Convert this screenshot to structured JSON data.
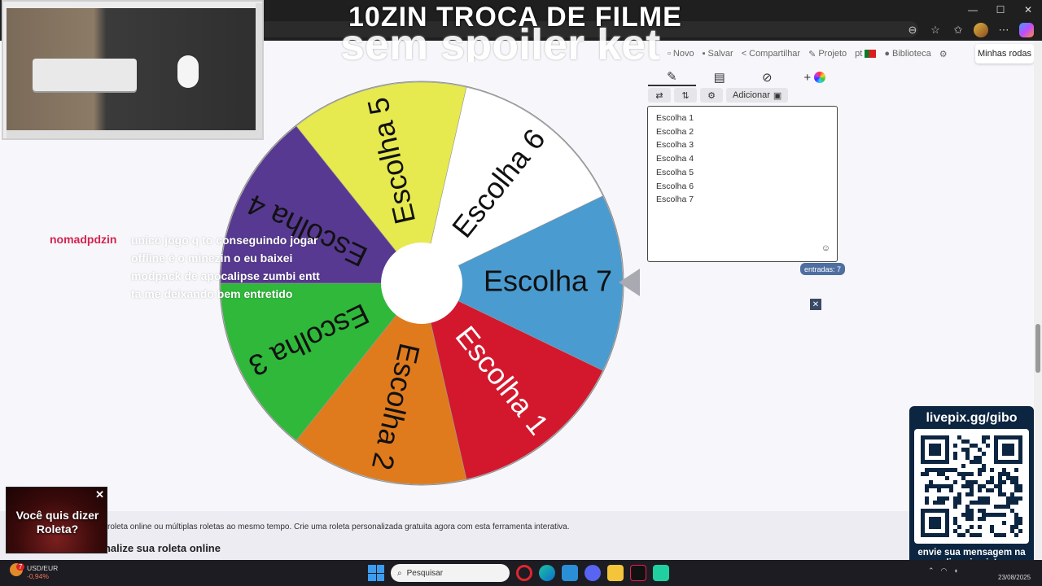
{
  "stream": {
    "title": "10ZIN TROCA DE FILME",
    "subtitle": "sem spoiler ket"
  },
  "browser": {
    "window_controls": [
      "—",
      "☐",
      "✕"
    ],
    "addr_icons": [
      "share-icon",
      "star-icon",
      "favorites-icon",
      "profile-avatar-icon",
      "copilot-icon"
    ]
  },
  "site_nav": {
    "items": [
      {
        "icon": "new-icon",
        "label": "Novo"
      },
      {
        "icon": "save-icon",
        "label": "Salvar"
      },
      {
        "icon": "share-icon",
        "label": "Compartilhar"
      },
      {
        "icon": "project-icon",
        "label": "Projeto"
      },
      {
        "icon": "language-icon",
        "label": "pt"
      },
      {
        "icon": "library-icon",
        "label": "Biblioteca"
      }
    ],
    "my_wheels_label": "Minhas rodas"
  },
  "wheel": {
    "segments": [
      {
        "label": "Escolha 1",
        "color": "#d3182d"
      },
      {
        "label": "Escolha 2",
        "color": "#e07b1d"
      },
      {
        "label": "Escolha 3",
        "color": "#2fb83a"
      },
      {
        "label": "Escolha 4",
        "color": "#573991"
      },
      {
        "label": "Escolha 5",
        "color": "#e6ea4f"
      },
      {
        "label": "Escolha 6",
        "color": "#ffffff"
      },
      {
        "label": "Escolha 7",
        "color": "#4a9bd0"
      }
    ]
  },
  "chat": {
    "user": "nomadpdzin",
    "message": "unico jogo q to conseguindo jogar offline é o minezin o eu baixei modpack de apocalipse zumbi entt ta me deixando bem entretido"
  },
  "editor": {
    "tabs": [
      {
        "icon": "pencil-icon",
        "label": "✎"
      },
      {
        "icon": "clipboard-icon",
        "label": "📋"
      },
      {
        "icon": "eye-off-icon",
        "label": "◌"
      },
      {
        "icon": "add-color-icon",
        "label": "+"
      }
    ],
    "tools": [
      {
        "icon": "shuffle-icon",
        "label": "⇄"
      },
      {
        "icon": "sort-icon",
        "label": "⇅"
      },
      {
        "icon": "settings-icon",
        "label": "⚙"
      }
    ],
    "add_label": "Adicionar",
    "entries": [
      "Escolha 1",
      "Escolha 2",
      "Escolha 3",
      "Escolha 4",
      "Escolha 5",
      "Escolha 6",
      "Escolha 7"
    ],
    "entries_count": "entradas: 7",
    "emoji": "☺",
    "close": "✕"
  },
  "page": {
    "description": "roleta online ou múltiplas roletas ao mesmo tempo. Crie uma roleta personalizada gratuita agora com esta ferramenta interativa.",
    "heading": "onalize sua roleta online"
  },
  "ad": {
    "text": "Você quis dizer Roleta?",
    "close": "✕"
  },
  "livepix": {
    "title": "livepix.gg/gibo",
    "caption": "envie sua mensagem na live via pix!"
  },
  "taskbar": {
    "weather_badge": "7",
    "ticker_name": "USD/EUR",
    "ticker_change": "-0,94%",
    "search_placeholder": "Pesquisar",
    "date": "23/08/2025"
  }
}
